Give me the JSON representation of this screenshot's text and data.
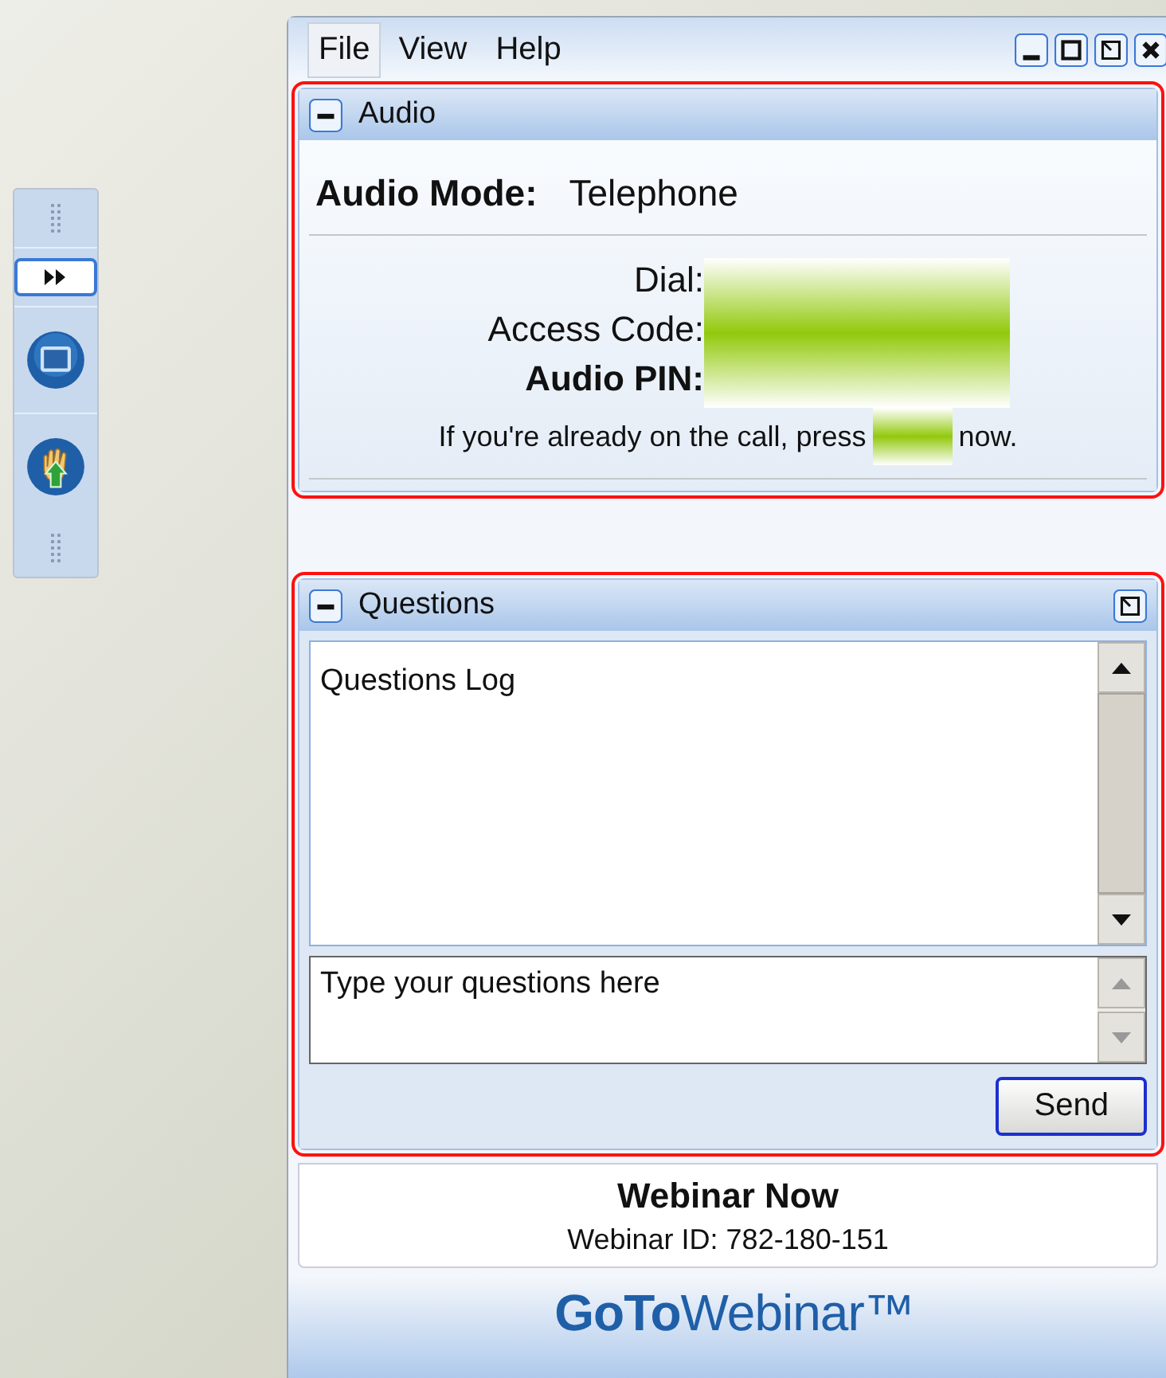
{
  "toolbar": {
    "buttons": [
      {
        "kind": "forward"
      },
      {
        "kind": "screen"
      },
      {
        "kind": "raise-hand"
      }
    ]
  },
  "menu": [
    {
      "label": "File",
      "selected": true
    },
    {
      "label": "View",
      "selected": false
    },
    {
      "label": "Help",
      "selected": false
    }
  ],
  "audio_panel": {
    "title": "Audio",
    "highlighted": true,
    "mode_label": "Audio Mode:",
    "mode_value": "Telephone",
    "fields": [
      {
        "label": "Dial:",
        "bold": false
      },
      {
        "label": "Access Code:",
        "bold": false
      },
      {
        "label": "Audio PIN:",
        "bold": true
      }
    ],
    "note_before": "If you're already on the call, press",
    "note_after": "now."
  },
  "questions_panel": {
    "title": "Questions",
    "highlighted": true,
    "log_text": "Questions Log",
    "input_placeholder": "Type your questions here",
    "send_label": "Send"
  },
  "footer": {
    "title": "Webinar Now",
    "webinar_id": "Webinar ID: 782-180-151",
    "logo": "**GoTo**Webinar™"
  }
}
